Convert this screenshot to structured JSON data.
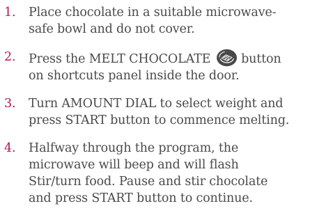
{
  "steps": [
    {
      "number": "1.",
      "lines": [
        "Place chocolate in a suitable microwave-",
        "safe bowl and do not cover."
      ]
    },
    {
      "number": "2.",
      "line1_before_icon": "Press the MELT CHOCOLATE",
      "line1_after_icon": "button",
      "line2": "on shortcuts panel inside the door.",
      "icon": "melt-chocolate-icon"
    },
    {
      "number": "3.",
      "lines": [
        "Turn AMOUNT DIAL to select weight and",
        "press START button to commence melting."
      ]
    },
    {
      "number": "4.",
      "lines": [
        "Halfway through the program, the",
        "microwave will beep and will flash",
        "Stir/turn food. Pause and stir chocolate",
        "and press START button to continue."
      ]
    }
  ],
  "colors": {
    "accent_number": "#b3164f",
    "text": "#4b4a4a",
    "icon_dark": "#4a4949",
    "icon_light": "#ffffff"
  }
}
